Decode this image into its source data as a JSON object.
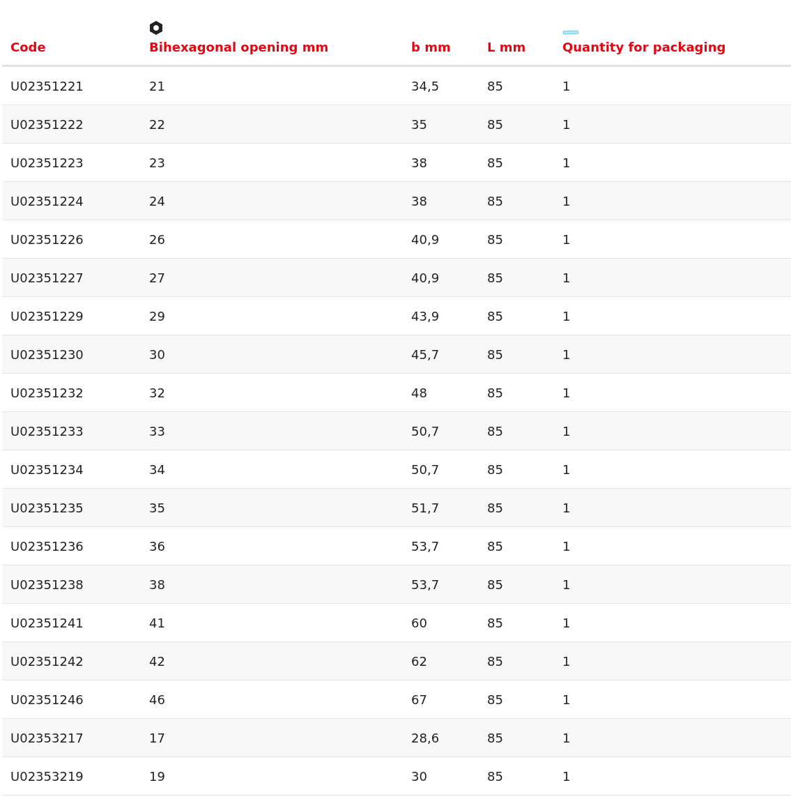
{
  "table": {
    "columns": [
      {
        "label": "Code",
        "kind": "plain"
      },
      {
        "label": "Bihexagonal opening mm",
        "kind": "nut"
      },
      {
        "label": "b mm",
        "kind": "plain"
      },
      {
        "label": "L mm",
        "kind": "plain"
      },
      {
        "label": "Quantity for packaging",
        "kind": "box"
      }
    ],
    "rows": [
      [
        "U02351221",
        "21",
        "34,5",
        "85",
        "1"
      ],
      [
        "U02351222",
        "22",
        "35",
        "85",
        "1"
      ],
      [
        "U02351223",
        "23",
        "38",
        "85",
        "1"
      ],
      [
        "U02351224",
        "24",
        "38",
        "85",
        "1"
      ],
      [
        "U02351226",
        "26",
        "40,9",
        "85",
        "1"
      ],
      [
        "U02351227",
        "27",
        "40,9",
        "85",
        "1"
      ],
      [
        "U02351229",
        "29",
        "43,9",
        "85",
        "1"
      ],
      [
        "U02351230",
        "30",
        "45,7",
        "85",
        "1"
      ],
      [
        "U02351232",
        "32",
        "48",
        "85",
        "1"
      ],
      [
        "U02351233",
        "33",
        "50,7",
        "85",
        "1"
      ],
      [
        "U02351234",
        "34",
        "50,7",
        "85",
        "1"
      ],
      [
        "U02351235",
        "35",
        "51,7",
        "85",
        "1"
      ],
      [
        "U02351236",
        "36",
        "53,7",
        "85",
        "1"
      ],
      [
        "U02351238",
        "38",
        "53,7",
        "85",
        "1"
      ],
      [
        "U02351241",
        "41",
        "60",
        "85",
        "1"
      ],
      [
        "U02351242",
        "42",
        "62",
        "85",
        "1"
      ],
      [
        "U02351246",
        "46",
        "67",
        "85",
        "1"
      ],
      [
        "U02353217",
        "17",
        "28,6",
        "85",
        "1"
      ],
      [
        "U02353219",
        "19",
        "30",
        "85",
        "1"
      ]
    ]
  }
}
